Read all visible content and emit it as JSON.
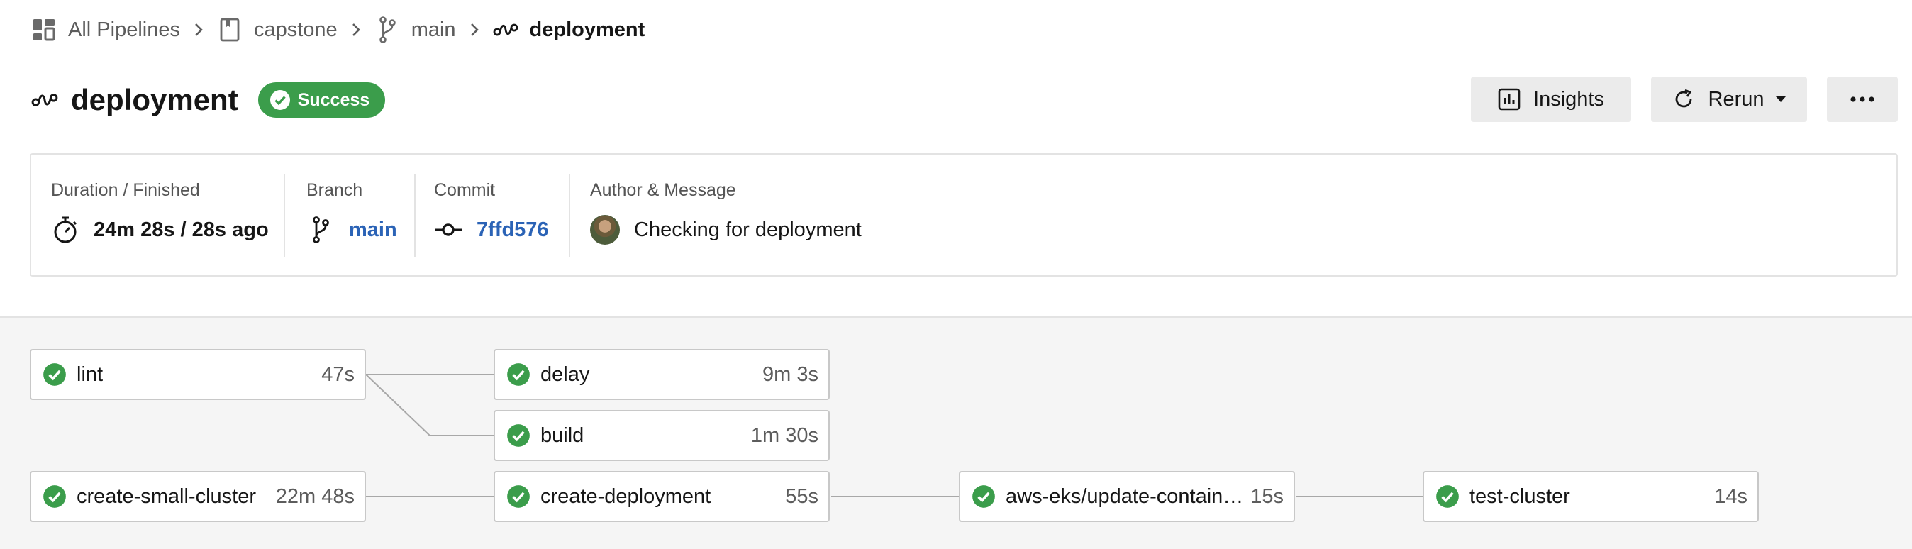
{
  "breadcrumb": {
    "all_pipelines": "All Pipelines",
    "project": "capstone",
    "branch": "main",
    "workflow": "deployment"
  },
  "header": {
    "title": "deployment",
    "status": "Success",
    "buttons": {
      "insights": "Insights",
      "rerun": "Rerun"
    }
  },
  "summary": {
    "duration_label": "Duration / Finished",
    "duration_value": "24m 28s / 28s ago",
    "branch_label": "Branch",
    "branch_value": "main",
    "commit_label": "Commit",
    "commit_value": "7ffd576",
    "author_label": "Author & Message",
    "message_value": "Checking for deployment"
  },
  "jobs": [
    {
      "name": "lint",
      "duration": "47s"
    },
    {
      "name": "delay",
      "duration": "9m 3s"
    },
    {
      "name": "build",
      "duration": "1m 30s"
    },
    {
      "name": "create-small-cluster",
      "duration": "22m 48s"
    },
    {
      "name": "create-deployment",
      "duration": "55s"
    },
    {
      "name": "aws-eks/update-container-image",
      "duration": "15s"
    },
    {
      "name": "test-cluster",
      "duration": "14s"
    }
  ],
  "colors": {
    "success": "#3b9d4b",
    "link": "#2b63b6",
    "workflow_bg": "#f5f5f5"
  },
  "icons": {
    "pipelines": "pipelines-grid-icon",
    "project": "bookmark-icon",
    "branch": "git-branch-icon",
    "workflow": "workflow-icon",
    "success": "check-circle-icon",
    "insights": "bar-chart-icon",
    "rerun": "refresh-icon",
    "more": "ellipsis-icon",
    "timer": "stopwatch-icon",
    "commit": "git-commit-icon"
  }
}
